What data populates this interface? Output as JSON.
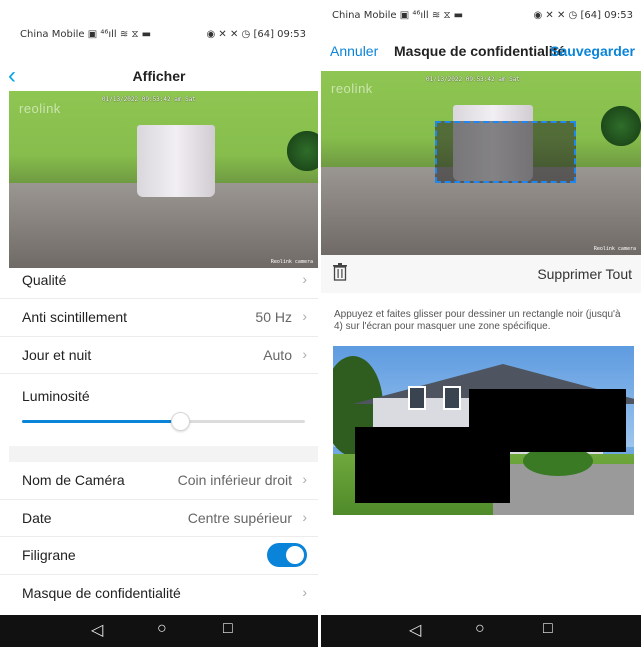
{
  "left": {
    "status": {
      "carrier": "China Mobile ▣ ⁴⁶ıll ≋ ⧖ ▬",
      "indicators": "◉ ✕ ✕ ◷ [64]",
      "time": "09:53"
    },
    "title": "Afficher",
    "video": {
      "logo": "reolink",
      "timestamp": "01/13/2022 09:53:42 am Sat",
      "cam_label": "Reolink camera"
    },
    "settings": {
      "quality": {
        "label": "Qualité"
      },
      "flicker": {
        "label": "Anti scintillement",
        "value": "50 Hz"
      },
      "daynight": {
        "label": "Jour et nuit",
        "value": "Auto"
      },
      "brightness": {
        "label": "Luminosité",
        "level": 0.56
      },
      "camname": {
        "label": "Nom de Caméra",
        "value": "Coin inférieur droit"
      },
      "date": {
        "label": "Date",
        "value": "Centre supérieur"
      },
      "watermark": {
        "label": "Filigrane",
        "on": true
      },
      "privacy": {
        "label": "Masque de confidentialité"
      }
    }
  },
  "right": {
    "status": {
      "carrier": "China Mobile ▣ ⁴⁶ıll ≋ ⧖ ▬",
      "indicators": "◉ ✕ ✕ ◷ [64]",
      "time": "09:53"
    },
    "cancel": "Annuler",
    "title": "Masque de confidentialité",
    "save": "Sauvegarder",
    "video": {
      "logo": "reolink",
      "timestamp": "01/13/2022 09:53:42 am Sat",
      "cam_label": "Reolink camera"
    },
    "delete_all": "Supprimer Tout",
    "hint": "Appuyez et faites glisser pour dessiner un rectangle noir (jusqu'à 4) sur l'écran pour masquer une zone spécifique."
  },
  "sysnav": {
    "back": "◁",
    "home": "○",
    "recent": "□"
  },
  "icons": {
    "back": "chevron-left-icon",
    "chevron": "chevron-right-icon",
    "trash": "trash-icon"
  },
  "colors": {
    "accent": "#0a84d8",
    "text": "#222222",
    "muted": "#666666"
  }
}
